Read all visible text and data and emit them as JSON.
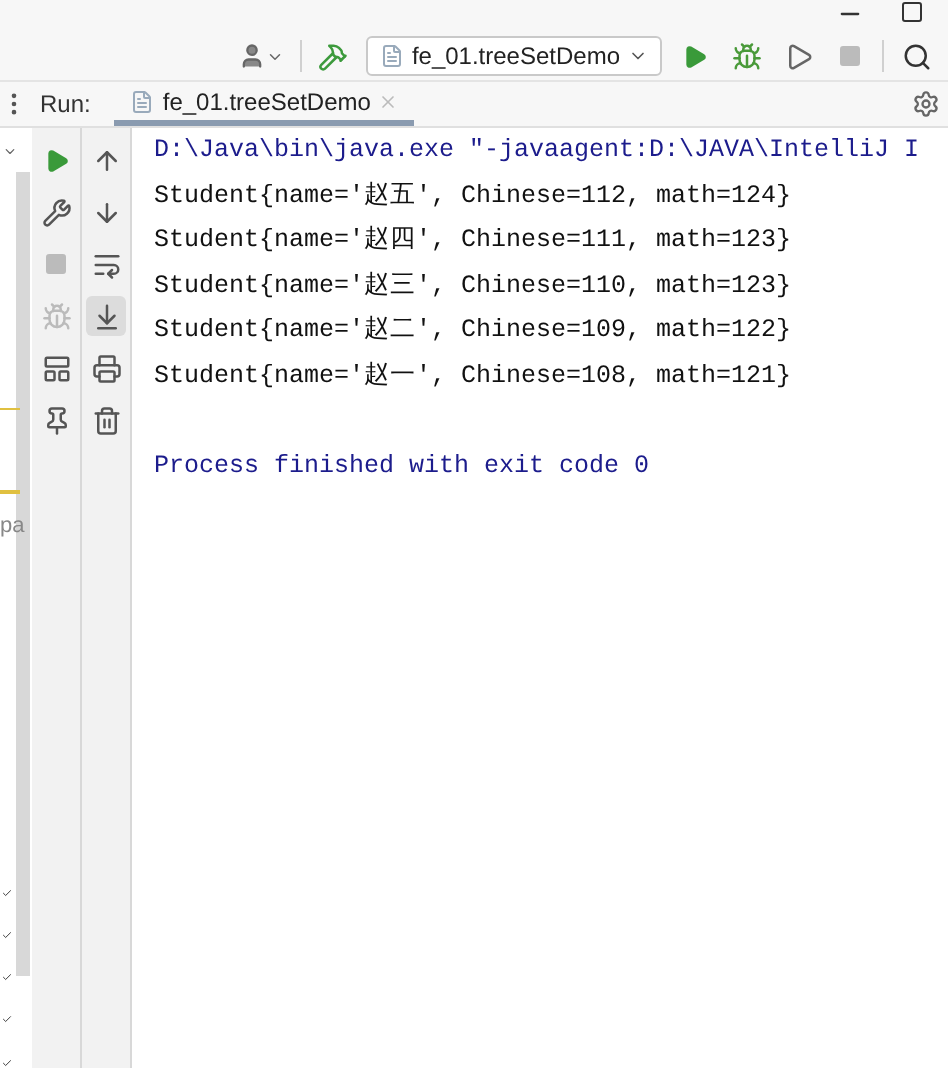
{
  "toolbar": {
    "run_configuration": "fe_01.treeSetDemo"
  },
  "run_panel": {
    "label": "Run:",
    "tabs": [
      {
        "label": "fe_01.treeSetDemo",
        "selected": true
      }
    ],
    "process_running": false,
    "scroll_to_end": true
  },
  "editor_fragment": {
    "text": "pa"
  },
  "console": {
    "lines": [
      {
        "kind": "command",
        "text": "D:\\Java\\bin\\java.exe \"-javaagent:D:\\JAVA\\IntelliJ I"
      },
      {
        "kind": "output",
        "text": "Student{name='赵五', Chinese=112, math=124}"
      },
      {
        "kind": "output",
        "text": "Student{name='赵四', Chinese=111, math=123}"
      },
      {
        "kind": "output",
        "text": "Student{name='赵三', Chinese=110, math=123}"
      },
      {
        "kind": "output",
        "text": "Student{name='赵二', Chinese=109, math=122}"
      },
      {
        "kind": "output",
        "text": "Student{name='赵一', Chinese=108, math=121}"
      },
      {
        "kind": "exit",
        "text": "Process finished with exit code 0"
      }
    ]
  }
}
